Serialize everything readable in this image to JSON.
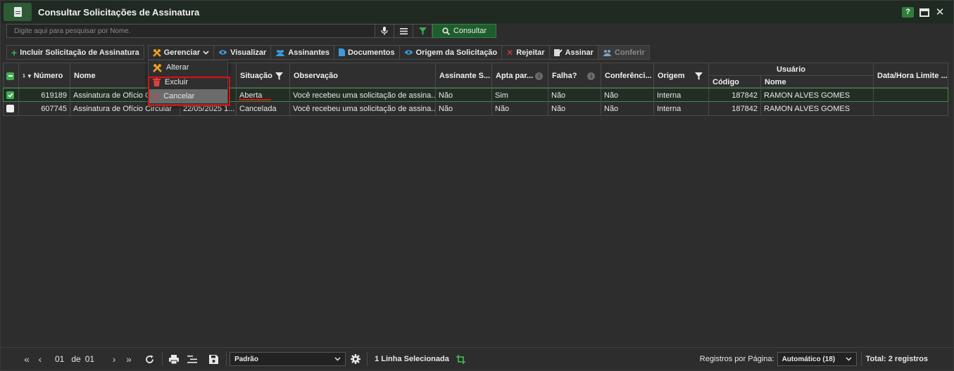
{
  "window": {
    "title": "Consultar Solicitações de Assinatura",
    "help": "?",
    "close": "✕"
  },
  "search": {
    "placeholder": "Digite aqui para pesquisar por Nome.",
    "value": "",
    "consultar_label": "Consultar"
  },
  "toolbar": {
    "incluir": "Incluir Solicitação de Assinatura",
    "gerenciar": "Gerenciar",
    "visualizar": "Visualizar",
    "assinantes": "Assinantes",
    "documentos": "Documentos",
    "origem": "Origem da Solicitação",
    "rejeitar": "Rejeitar",
    "assinar": "Assinar",
    "conferir": "Conferir"
  },
  "menu": {
    "alterar": "Alterar",
    "excluir": "Excluir",
    "cancelar": "Cancelar"
  },
  "grid": {
    "headers": {
      "sort_index": "1",
      "numero": "Número",
      "nome": "Nome",
      "situacao": "Situação",
      "observacao": "Observação",
      "assinante": "Assinante S...",
      "apta": "Apta par...",
      "falha": "Falha?",
      "conferencia": "Conferênci...",
      "origem": "Origem",
      "usuario": "Usuário",
      "codigo": "Código",
      "usuario_nome": "Nome",
      "datahora": "Data/Hora Limite ..."
    },
    "rows": [
      {
        "numero": "619189",
        "nome": "Assinatura de Ofício Circular",
        "data": "",
        "situacao": "Aberta",
        "observacao": "Você recebeu uma solicitação de assina...",
        "assinante": "Não",
        "apta": "Sim",
        "falha": "Não",
        "conferencia": "Não",
        "origem": "Interna",
        "codigo": "187842",
        "usuario_nome": "RAMON ALVES GOMES",
        "datahora": ""
      },
      {
        "numero": "607745",
        "nome": "Assinatura de Ofício Circular",
        "data": "22/05/2025 1...",
        "situacao": "Cancelada",
        "observacao": "Você recebeu uma solicitação de assina...",
        "assinante": "Não",
        "apta": "Não",
        "falha": "Não",
        "conferencia": "Não",
        "origem": "Interna",
        "codigo": "187842",
        "usuario_nome": "RAMON ALVES GOMES",
        "datahora": ""
      }
    ]
  },
  "footer": {
    "page_current": "01",
    "page_de": "de",
    "page_total": "01",
    "layout_select": "Padrão",
    "selected_text": "1 Linha Selecionada",
    "registros_label": "Registros por Página:",
    "registros_select": "Automático (18)",
    "total": "Total: 2 registros"
  },
  "colors": {
    "accent": "#2f7d3a",
    "selection_border": "#3d8a4a",
    "highlight_red": "#e01010"
  }
}
